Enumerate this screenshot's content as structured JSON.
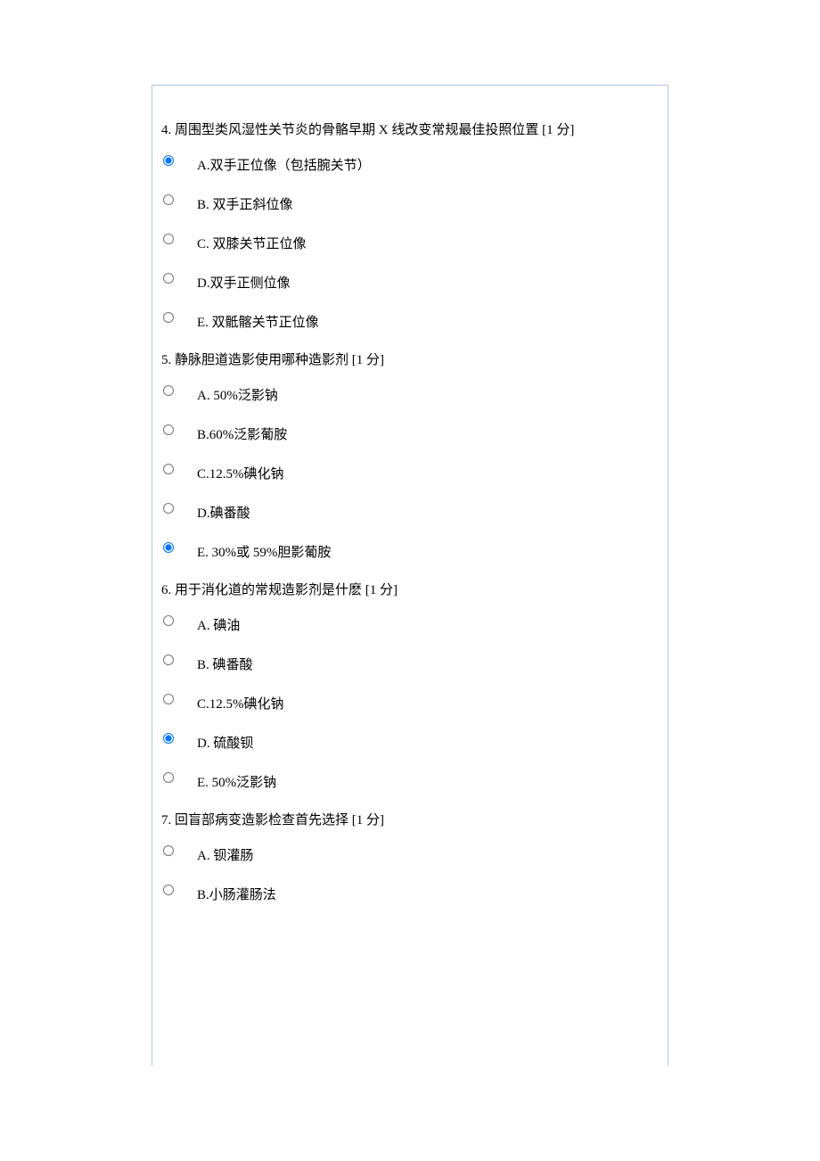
{
  "questions": [
    {
      "number": "4.",
      "stem": " 周围型类风湿性关节炎的骨骼早期 X 线改变常规最佳投照位置 ",
      "points": " [1 分]",
      "selected": 0,
      "options": [
        "A.双手正位像（包括腕关节）",
        "B.  双手正斜位像",
        "C.  双膝关节正位像",
        "D.双手正侧位像",
        "E.  双骶髂关节正位像"
      ]
    },
    {
      "number": "5.",
      "stem": " 静脉胆道造影使用哪种造影剂 ",
      "points": " [1 分]",
      "selected": 4,
      "options": [
        "A. 50%泛影钠",
        "B.60%泛影葡胺",
        "C.12.5%碘化钠",
        "D.碘番酸",
        "E. 30%或 59%胆影葡胺"
      ]
    },
    {
      "number": "6.",
      "stem": " 用于消化道的常规造影剂是什麽 ",
      "points": " [1 分]",
      "selected": 3,
      "options": [
        "A.  碘油",
        "B.  碘番酸",
        "C.12.5%碘化钠",
        "D.  硫酸钡",
        "E. 50%泛影钠"
      ]
    },
    {
      "number": "7.",
      "stem": " 回盲部病变造影检查首先选择 ",
      "points": " [1 分]",
      "selected": -1,
      "options": [
        "A.  钡灌肠",
        "B.小肠灌肠法"
      ]
    }
  ]
}
